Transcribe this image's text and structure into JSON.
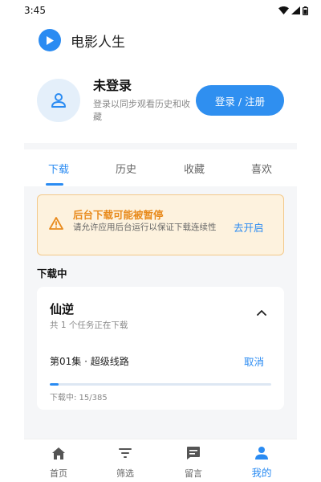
{
  "status_bar": {
    "time": "3:45"
  },
  "app": {
    "title": "电影人生"
  },
  "profile": {
    "name": "未登录",
    "hint": "登录以同步观看历史和收藏",
    "login_label": "登录 / 注册"
  },
  "tabs": [
    {
      "label": "下载",
      "active": true
    },
    {
      "label": "历史",
      "active": false
    },
    {
      "label": "收藏",
      "active": false
    },
    {
      "label": "喜欢",
      "active": false
    }
  ],
  "warning": {
    "title": "后台下载可能被暂停",
    "body": "请允许应用后台运行以保证下载连续性",
    "action": "去开启"
  },
  "downloads": {
    "section_title": "下载中",
    "item": {
      "title": "仙逆",
      "subtitle": "共 1 个任务正在下载",
      "episode": "第01集 · 超级线路",
      "cancel_label": "取消",
      "progress_text": "下载中: 15/385",
      "progress_current": 15,
      "progress_total": 385
    }
  },
  "bottom_nav": [
    {
      "label": "首页",
      "icon": "home-icon",
      "active": false
    },
    {
      "label": "筛选",
      "icon": "filter-icon",
      "active": false
    },
    {
      "label": "留言",
      "icon": "message-icon",
      "active": false
    },
    {
      "label": "我的",
      "icon": "person-icon",
      "active": true
    }
  ],
  "colors": {
    "accent": "#2a8bf2",
    "warning_text": "#e88a1c",
    "warning_bg": "#fdf2de"
  }
}
